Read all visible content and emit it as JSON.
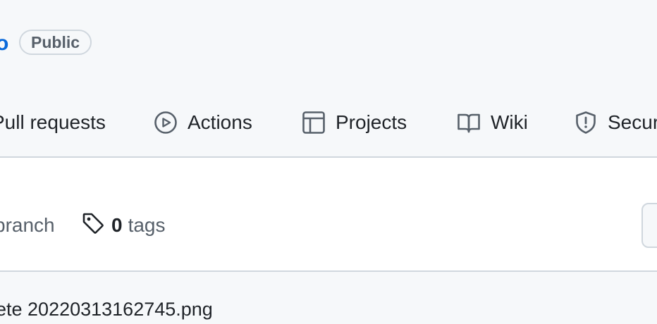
{
  "repo": {
    "name_fragment": "o",
    "visibility": "Public"
  },
  "tabs": [
    {
      "label": "Pull requests",
      "icon": "pull-request-icon"
    },
    {
      "label": "Actions",
      "icon": "play-icon"
    },
    {
      "label": "Projects",
      "icon": "table-icon"
    },
    {
      "label": "Wiki",
      "icon": "book-icon"
    },
    {
      "label": "Secur",
      "icon": "shield-icon"
    }
  ],
  "meta": {
    "branch_text": "branch",
    "tags_count": "0",
    "tags_label": "tags"
  },
  "commit": {
    "message": "ete 20220313162745.png"
  },
  "colors": {
    "accent": "#0969da",
    "header_bg": "#f6f8fa",
    "border": "#d0d7de",
    "muted_text": "#57606a"
  }
}
